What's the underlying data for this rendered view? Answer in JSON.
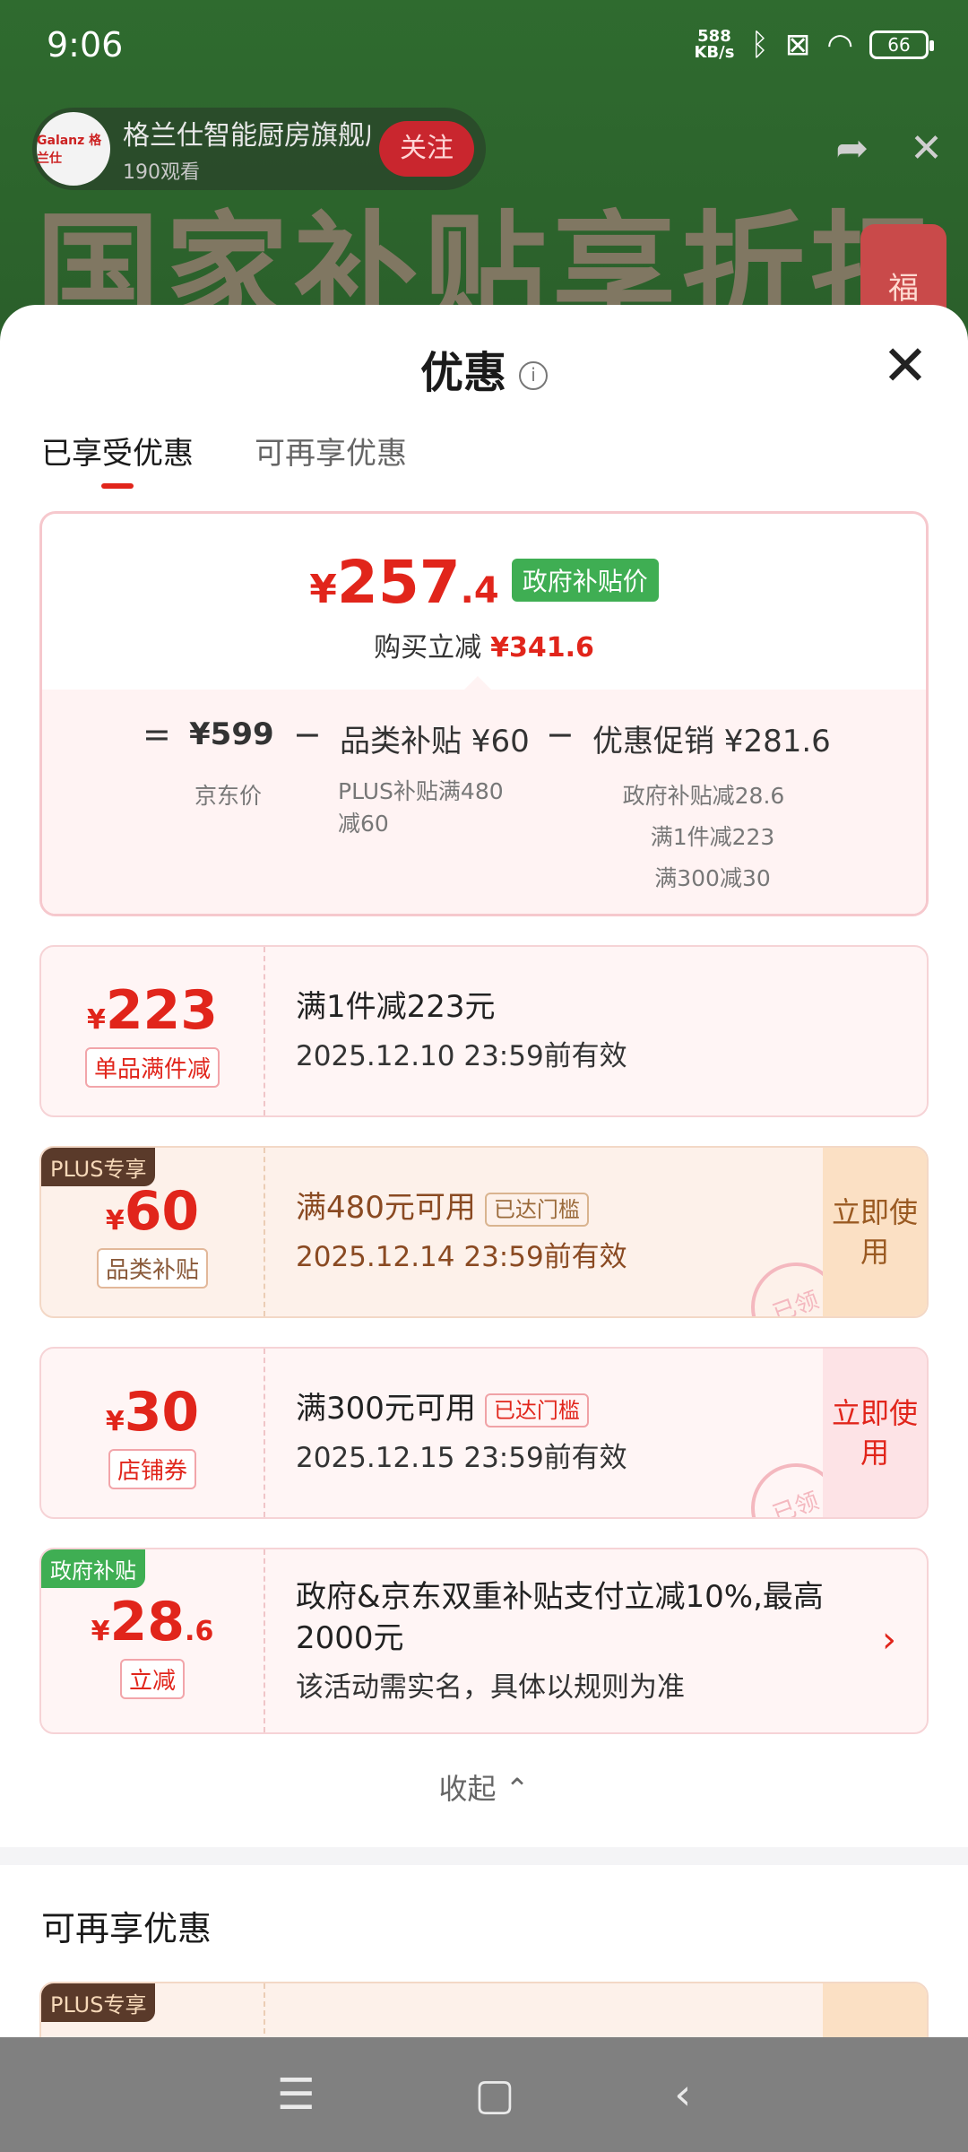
{
  "status_bar": {
    "time": "9:06",
    "net_speed_value": "588",
    "net_speed_unit": "KB/s",
    "battery": "66"
  },
  "live": {
    "shop_name": "格兰仕智能厨房旗舰店",
    "views": "190观看",
    "follow_label": "关注",
    "avatar_text": "Galanz 格兰仕",
    "banner_text": "国家补贴享折扣",
    "fu_text": "福"
  },
  "sheet": {
    "title": "优惠",
    "info_icon": "i",
    "close_icon": "✕",
    "tabs": [
      {
        "label": "已享受优惠",
        "active": true
      },
      {
        "label": "可再享优惠",
        "active": false
      }
    ]
  },
  "summary": {
    "yen": "¥",
    "price_int": "257",
    "price_dec": ".4",
    "gov_badge": "政府补贴价",
    "saved_label": "购买立减",
    "saved_value": "¥341.6",
    "eq": "=",
    "minus": "−",
    "jd_price": "¥599",
    "jd_price_label": "京东价",
    "cat_subsidy": "品类补贴 ¥60",
    "cat_subsidy_sub1": "PLUS补贴满480",
    "cat_subsidy_sub2": "减60",
    "promo": "优惠促销 ¥281.6",
    "promo_sub1": "政府补贴减28.6",
    "promo_sub2": "满1件减223",
    "promo_sub3": "满300减30"
  },
  "coupons": [
    {
      "yen": "¥",
      "int": "223",
      "dec": "",
      "tag": "单品满件减",
      "title": "满1件减223元",
      "date": "2025.12.10 23:59前有效"
    },
    {
      "corner": "PLUS专享",
      "yen": "¥",
      "int": "60",
      "dec": "",
      "tag": "品类补贴",
      "title": "满480元可用",
      "badge": "已达门槛",
      "date": "2025.12.14 23:59前有效",
      "action": "立即使用",
      "stamp": "已领"
    },
    {
      "yen": "¥",
      "int": "30",
      "dec": "",
      "tag": "店铺券",
      "title": "满300元可用",
      "badge": "已达门槛",
      "date": "2025.12.15 23:59前有效",
      "action": "立即使用",
      "stamp": "已领"
    },
    {
      "corner": "政府补贴",
      "yen": "¥",
      "int": "28",
      "dec": ".6",
      "tag": "立减",
      "title": "政府&京东双重补贴支付立减10%,最高2000元",
      "date": "该活动需实名，具体以规则为准",
      "arrow": "›"
    }
  ],
  "collapse_label": "收起 ⌃",
  "more_section": {
    "title": "可再享优惠",
    "corner": "PLUS专享"
  },
  "navbar": {
    "menu_icon": "☰",
    "home_icon": "▢",
    "back_icon": "‹"
  }
}
